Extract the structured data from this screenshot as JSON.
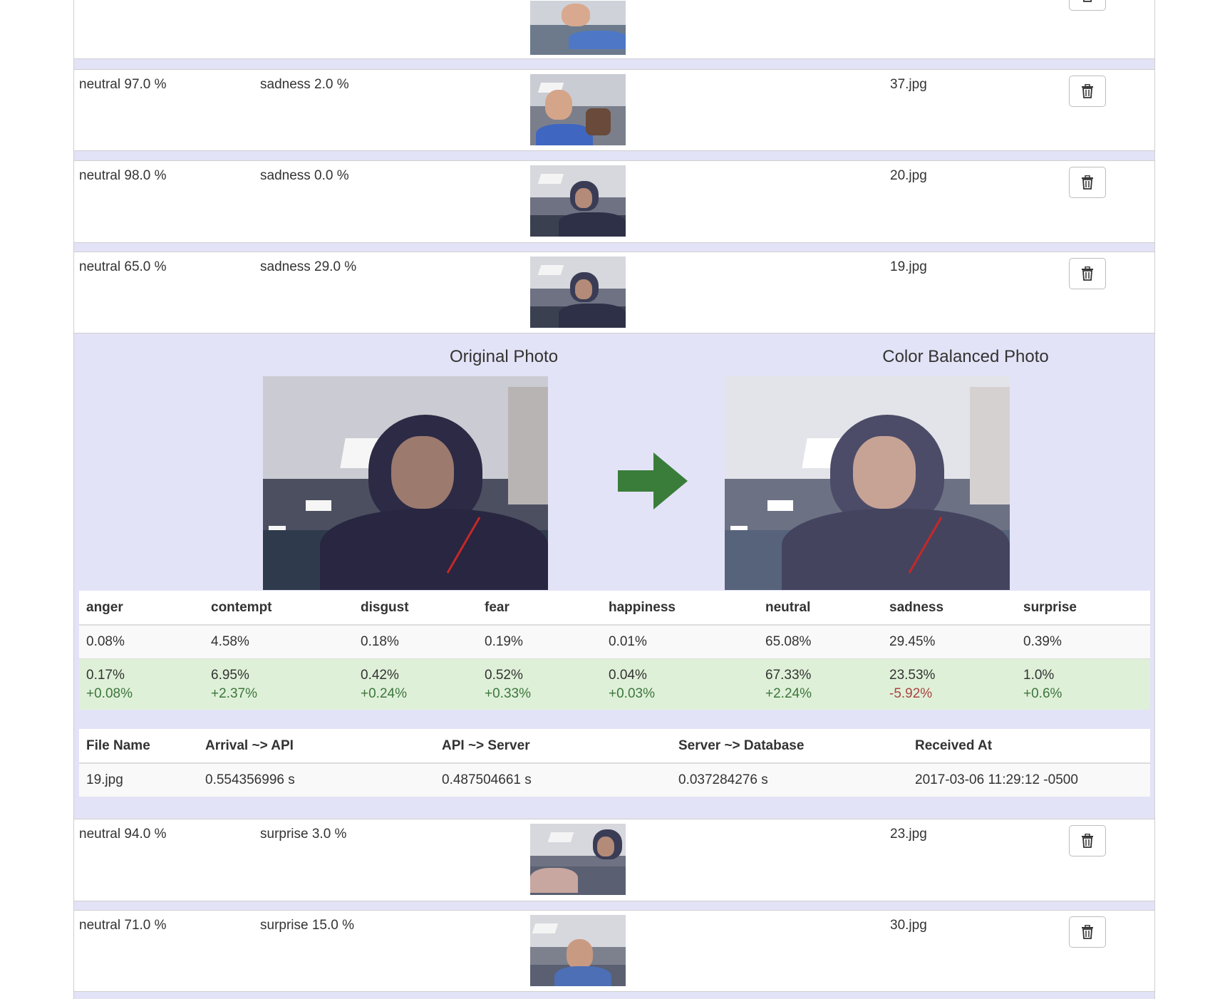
{
  "rows_top": [
    {
      "emotion1": "",
      "emotion2": "",
      "file": ""
    },
    {
      "emotion1": "neutral 97.0 %",
      "emotion2": "sadness 2.0 %",
      "file": "37.jpg"
    },
    {
      "emotion1": "neutral 98.0 %",
      "emotion2": "sadness 0.0 %",
      "file": "20.jpg"
    },
    {
      "emotion1": "neutral 65.0 %",
      "emotion2": "sadness 29.0 %",
      "file": "19.jpg"
    }
  ],
  "detail": {
    "original_title": "Original Photo",
    "balanced_title": "Color Balanced Photo",
    "emotion_headers": [
      "anger",
      "contempt",
      "disgust",
      "fear",
      "happiness",
      "neutral",
      "sadness",
      "surprise"
    ],
    "original_values": [
      "0.08%",
      "4.58%",
      "0.18%",
      "0.19%",
      "0.01%",
      "65.08%",
      "29.45%",
      "0.39%"
    ],
    "balanced_values": [
      "0.17%",
      "6.95%",
      "0.42%",
      "0.52%",
      "0.04%",
      "67.33%",
      "23.53%",
      "1.0%"
    ],
    "deltas": [
      "+0.08%",
      "+2.37%",
      "+0.24%",
      "+0.33%",
      "+0.03%",
      "+2.24%",
      "-5.92%",
      "+0.6%"
    ],
    "timing_headers": [
      "File Name",
      "Arrival ~> API",
      "API ~> Server",
      "Server ~> Database",
      "Received At"
    ],
    "timing_values": [
      "19.jpg",
      "0.554356996 s",
      "0.487504661 s",
      "0.037284276 s",
      "2017-03-06 11:29:12 -0500"
    ]
  },
  "rows_bottom": [
    {
      "emotion1": "neutral 94.0 %",
      "emotion2": "surprise 3.0 %",
      "file": "23.jpg"
    },
    {
      "emotion1": "neutral 71.0 %",
      "emotion2": "surprise 15.0 %",
      "file": "30.jpg"
    }
  ],
  "colors": {
    "panel_background": "#e3e3f7",
    "positive_delta": "#3c763d",
    "negative_delta": "#a94442",
    "balanced_row": "#dff0d8",
    "arrow": "#3a7d3a"
  },
  "icons": {
    "delete": "trash-icon",
    "arrow": "arrow-right-icon"
  }
}
